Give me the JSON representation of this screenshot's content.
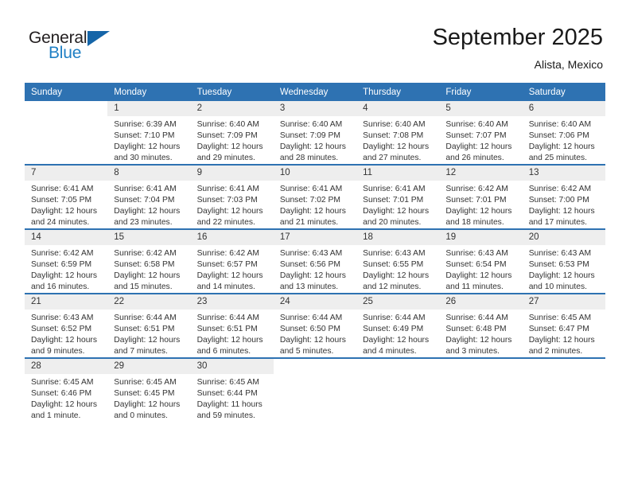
{
  "brand": {
    "name_part1": "General",
    "name_part2": "Blue"
  },
  "header": {
    "title": "September 2025",
    "location": "Alista, Mexico"
  },
  "colors": {
    "header_blue": "#2e72b2",
    "brand_blue": "#1f7fc4",
    "daynum_band": "#eeeeee",
    "text": "#333333"
  },
  "weekdays": [
    "Sunday",
    "Monday",
    "Tuesday",
    "Wednesday",
    "Thursday",
    "Friday",
    "Saturday"
  ],
  "weeks": [
    [
      {
        "day": "",
        "sunrise": "",
        "sunset": "",
        "daylight": "",
        "blank": true
      },
      {
        "day": "1",
        "sunrise": "Sunrise: 6:39 AM",
        "sunset": "Sunset: 7:10 PM",
        "daylight": "Daylight: 12 hours and 30 minutes."
      },
      {
        "day": "2",
        "sunrise": "Sunrise: 6:40 AM",
        "sunset": "Sunset: 7:09 PM",
        "daylight": "Daylight: 12 hours and 29 minutes."
      },
      {
        "day": "3",
        "sunrise": "Sunrise: 6:40 AM",
        "sunset": "Sunset: 7:09 PM",
        "daylight": "Daylight: 12 hours and 28 minutes."
      },
      {
        "day": "4",
        "sunrise": "Sunrise: 6:40 AM",
        "sunset": "Sunset: 7:08 PM",
        "daylight": "Daylight: 12 hours and 27 minutes."
      },
      {
        "day": "5",
        "sunrise": "Sunrise: 6:40 AM",
        "sunset": "Sunset: 7:07 PM",
        "daylight": "Daylight: 12 hours and 26 minutes."
      },
      {
        "day": "6",
        "sunrise": "Sunrise: 6:40 AM",
        "sunset": "Sunset: 7:06 PM",
        "daylight": "Daylight: 12 hours and 25 minutes."
      }
    ],
    [
      {
        "day": "7",
        "sunrise": "Sunrise: 6:41 AM",
        "sunset": "Sunset: 7:05 PM",
        "daylight": "Daylight: 12 hours and 24 minutes."
      },
      {
        "day": "8",
        "sunrise": "Sunrise: 6:41 AM",
        "sunset": "Sunset: 7:04 PM",
        "daylight": "Daylight: 12 hours and 23 minutes."
      },
      {
        "day": "9",
        "sunrise": "Sunrise: 6:41 AM",
        "sunset": "Sunset: 7:03 PM",
        "daylight": "Daylight: 12 hours and 22 minutes."
      },
      {
        "day": "10",
        "sunrise": "Sunrise: 6:41 AM",
        "sunset": "Sunset: 7:02 PM",
        "daylight": "Daylight: 12 hours and 21 minutes."
      },
      {
        "day": "11",
        "sunrise": "Sunrise: 6:41 AM",
        "sunset": "Sunset: 7:01 PM",
        "daylight": "Daylight: 12 hours and 20 minutes."
      },
      {
        "day": "12",
        "sunrise": "Sunrise: 6:42 AM",
        "sunset": "Sunset: 7:01 PM",
        "daylight": "Daylight: 12 hours and 18 minutes."
      },
      {
        "day": "13",
        "sunrise": "Sunrise: 6:42 AM",
        "sunset": "Sunset: 7:00 PM",
        "daylight": "Daylight: 12 hours and 17 minutes."
      }
    ],
    [
      {
        "day": "14",
        "sunrise": "Sunrise: 6:42 AM",
        "sunset": "Sunset: 6:59 PM",
        "daylight": "Daylight: 12 hours and 16 minutes."
      },
      {
        "day": "15",
        "sunrise": "Sunrise: 6:42 AM",
        "sunset": "Sunset: 6:58 PM",
        "daylight": "Daylight: 12 hours and 15 minutes."
      },
      {
        "day": "16",
        "sunrise": "Sunrise: 6:42 AM",
        "sunset": "Sunset: 6:57 PM",
        "daylight": "Daylight: 12 hours and 14 minutes."
      },
      {
        "day": "17",
        "sunrise": "Sunrise: 6:43 AM",
        "sunset": "Sunset: 6:56 PM",
        "daylight": "Daylight: 12 hours and 13 minutes."
      },
      {
        "day": "18",
        "sunrise": "Sunrise: 6:43 AM",
        "sunset": "Sunset: 6:55 PM",
        "daylight": "Daylight: 12 hours and 12 minutes."
      },
      {
        "day": "19",
        "sunrise": "Sunrise: 6:43 AM",
        "sunset": "Sunset: 6:54 PM",
        "daylight": "Daylight: 12 hours and 11 minutes."
      },
      {
        "day": "20",
        "sunrise": "Sunrise: 6:43 AM",
        "sunset": "Sunset: 6:53 PM",
        "daylight": "Daylight: 12 hours and 10 minutes."
      }
    ],
    [
      {
        "day": "21",
        "sunrise": "Sunrise: 6:43 AM",
        "sunset": "Sunset: 6:52 PM",
        "daylight": "Daylight: 12 hours and 9 minutes."
      },
      {
        "day": "22",
        "sunrise": "Sunrise: 6:44 AM",
        "sunset": "Sunset: 6:51 PM",
        "daylight": "Daylight: 12 hours and 7 minutes."
      },
      {
        "day": "23",
        "sunrise": "Sunrise: 6:44 AM",
        "sunset": "Sunset: 6:51 PM",
        "daylight": "Daylight: 12 hours and 6 minutes."
      },
      {
        "day": "24",
        "sunrise": "Sunrise: 6:44 AM",
        "sunset": "Sunset: 6:50 PM",
        "daylight": "Daylight: 12 hours and 5 minutes."
      },
      {
        "day": "25",
        "sunrise": "Sunrise: 6:44 AM",
        "sunset": "Sunset: 6:49 PM",
        "daylight": "Daylight: 12 hours and 4 minutes."
      },
      {
        "day": "26",
        "sunrise": "Sunrise: 6:44 AM",
        "sunset": "Sunset: 6:48 PM",
        "daylight": "Daylight: 12 hours and 3 minutes."
      },
      {
        "day": "27",
        "sunrise": "Sunrise: 6:45 AM",
        "sunset": "Sunset: 6:47 PM",
        "daylight": "Daylight: 12 hours and 2 minutes."
      }
    ],
    [
      {
        "day": "28",
        "sunrise": "Sunrise: 6:45 AM",
        "sunset": "Sunset: 6:46 PM",
        "daylight": "Daylight: 12 hours and 1 minute."
      },
      {
        "day": "29",
        "sunrise": "Sunrise: 6:45 AM",
        "sunset": "Sunset: 6:45 PM",
        "daylight": "Daylight: 12 hours and 0 minutes."
      },
      {
        "day": "30",
        "sunrise": "Sunrise: 6:45 AM",
        "sunset": "Sunset: 6:44 PM",
        "daylight": "Daylight: 11 hours and 59 minutes."
      },
      {
        "day": "",
        "sunrise": "",
        "sunset": "",
        "daylight": "",
        "blank": true
      },
      {
        "day": "",
        "sunrise": "",
        "sunset": "",
        "daylight": "",
        "blank": true
      },
      {
        "day": "",
        "sunrise": "",
        "sunset": "",
        "daylight": "",
        "blank": true
      },
      {
        "day": "",
        "sunrise": "",
        "sunset": "",
        "daylight": "",
        "blank": true
      }
    ]
  ]
}
